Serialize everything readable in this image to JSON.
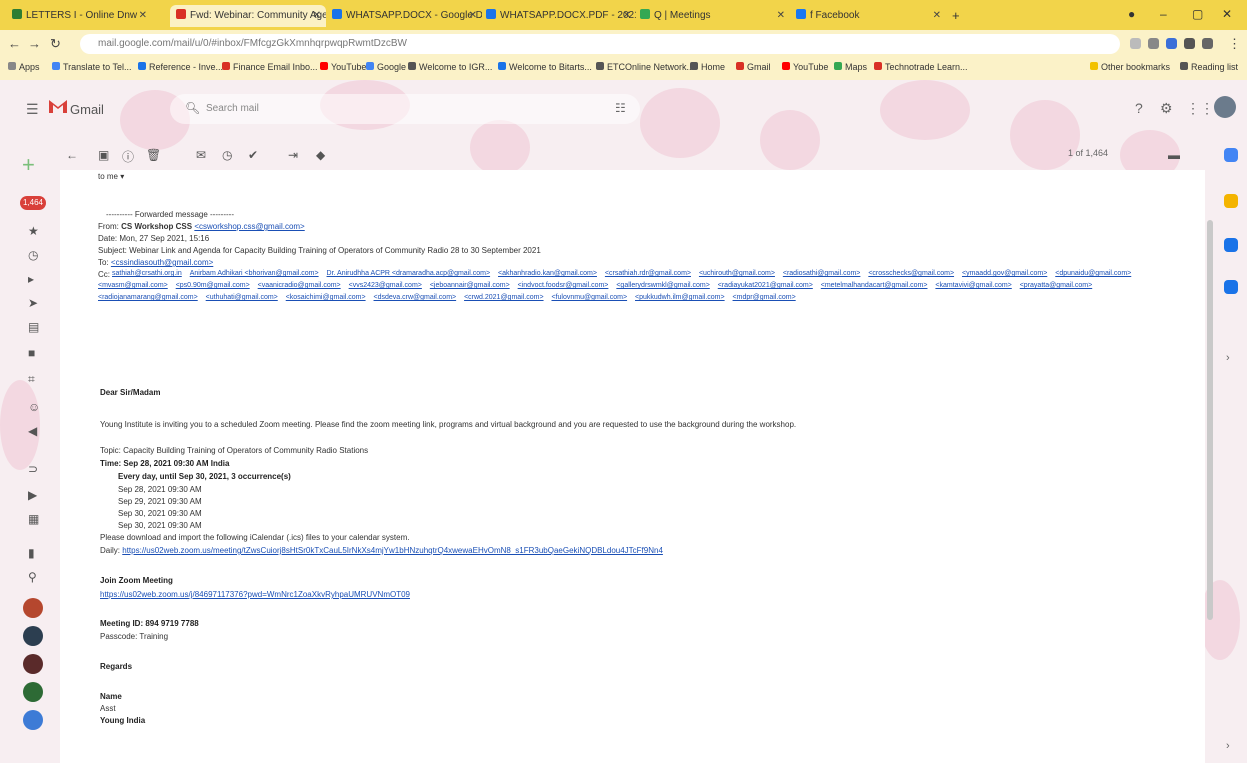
{
  "browser": {
    "tabs": [
      {
        "label": "LETTERS I - Online Dnw",
        "color": "#2e7d32"
      },
      {
        "label": "Fwd: Webinar: Community Agency",
        "color": "#d93025"
      },
      {
        "label": "WHATSAPP.DOCX - Google D",
        "color": "#1a73e8"
      },
      {
        "label": "WHATSAPP.DOCX.PDF - 2021-2",
        "color": "#1a73e8"
      },
      {
        "label": "Q | Meetings",
        "color": "#34a853"
      },
      {
        "label": "f Facebook",
        "color": "#1877f2"
      }
    ],
    "new_tab": "+",
    "address_url": "mail.google.com/mail/u/0/#inbox/FMfcgzGkXmnhqrpwqpRwmtDzcBW",
    "bookmarks": [
      {
        "label": "Apps",
        "color": "#888888"
      },
      {
        "label": "Translate to Tel...",
        "color": "#4285f4"
      },
      {
        "label": "Reference - Inve...",
        "color": "#1a73e8"
      },
      {
        "label": "Finance Email Inbo...",
        "color": "#d93025"
      },
      {
        "label": "YouTube",
        "color": "#ff0000"
      },
      {
        "label": "Google",
        "color": "#4285f4"
      },
      {
        "label": "Welcome to IGR...",
        "color": "#555555"
      },
      {
        "label": "Welcome to Bitarts...",
        "color": "#1a73e8"
      },
      {
        "label": "ETCOnline Network...",
        "color": "#555555"
      },
      {
        "label": "Home",
        "color": "#555555"
      },
      {
        "label": "Gmail",
        "color": "#d93025"
      },
      {
        "label": "YouTube",
        "color": "#ff0000"
      },
      {
        "label": "Maps",
        "color": "#34a853"
      },
      {
        "label": "Technotrade Learn...",
        "color": "#d93025"
      },
      {
        "label": "Other bookmarks",
        "color": "#f2c200"
      },
      {
        "label": "Reading list",
        "color": "#555555"
      }
    ]
  },
  "gmail": {
    "product": "Gmail",
    "search_placeholder": "Search mail",
    "inbox_badge": "1,464",
    "toolbar_count": "1 of 1,464"
  },
  "email": {
    "snippet_top": "to me ▾",
    "forwarded_header": "---------- Forwarded message ---------",
    "from_label": "From:",
    "from_name": "CS Workshop CSS",
    "from_email": "<csworkshop.css@gmail.com>",
    "date_line": "Date: Mon, 27 Sep 2021, 15:16",
    "subject_line": "Subject: Webinar Link and Agenda for Capacity Building Training of Operators of Community Radio 28 to 30 September 2021",
    "to_label": "To:",
    "to_email": "<cssindiasouth@gmail.com>",
    "cc_label": "Cc:",
    "cc_emails": [
      "sathiah@crsathi.org.in",
      "Anirbam Adhikari <bhorivan@gmail.com>",
      "Dr. Anirudhha ACPR <dramaradha.acp@gmail.com>",
      "<akhanhradio.kan@gmail.com>",
      "<crsathiah.rdr@gmail.com>",
      "<uchirouth@gmail.com>",
      "<radiosathi@gmail.com>",
      "<crosschecks@gmail.com>",
      "<ymaadd.gov@gmail.com>",
      "<dpunaidu@gmail.com>",
      "<mvasm@gmail.com>",
      "<ps0.90m@gmail.com>",
      "<vaanicradio@gmail.com>",
      "<vvs2423@gmail.com>",
      "<jeboannair@gmail.com>",
      "<indvoct.foodsr@gmail.com>",
      "<gallerydrswmkl@gmail.com>",
      "<radiayukat2021@gmail.com>",
      "<metelmalhandacart@gmail.com>",
      "<kamtavivi@gmail.com>",
      "<prayatta@gmail.com>",
      "<radiojanamarang@gmail.com>",
      "<uthuhati@gmail.com>",
      "<kosaichimi@gmail.com>",
      "<dsdeva.crw@gmail.com>",
      "<crwd.2021@gmail.com>",
      "<fulovnmu@gmail.com>",
      "<pukkudwh.ilm@gmail.com>",
      "<mdpr@gmail.com>"
    ],
    "greeting": "Dear Sir/Madam",
    "body_intro": "Young Institute is inviting you to a scheduled Zoom meeting. Please find the zoom meeting link, programs and virtual background and you are requested to use the background during the workshop.",
    "topic_line": "Topic: Capacity Building Training of Operators of Community Radio Stations",
    "time_line": "Time: Sep 28, 2021 09:30 AM India",
    "every_day_line": "Every day, until Sep 30, 2021, 3 occurrence(s)",
    "occurrences": [
      "Sep 28, 2021 09:30 AM",
      "Sep 29, 2021 09:30 AM",
      "Sep 30, 2021 09:30 AM",
      "Sep 30, 2021 09:30 AM"
    ],
    "calendar_note": "Please download and import the following iCalendar (.ics) files to your calendar system.",
    "daily_label": "Daily:",
    "daily_link": "https://us02web.zoom.us/meeting/tZwsCuiorj8sHtSr0kTxCauL5IrNkXs4mjYw1bHNzuhqtrQ4xwewaEHvOmN8_s1FR3ubQaeGekiNQDBLdou4JTcFf9Nn4",
    "join_label": "Join Zoom Meeting",
    "join_link": "https://us02web.zoom.us/j/84697117376?pwd=WmNrc1ZoaXkvRyhpaUMRUVNmOT09",
    "meeting_id": "Meeting ID: 894 9719 7788",
    "passcode": "Passcode: Training",
    "regards": "Regards",
    "sig_name": "Name",
    "sig_line2": "Asst",
    "sig_org": "Young India"
  },
  "colors": {
    "tabstrip": "#f2d44a",
    "gmail_red": "#d9403a",
    "link": "#1a4fb5"
  }
}
